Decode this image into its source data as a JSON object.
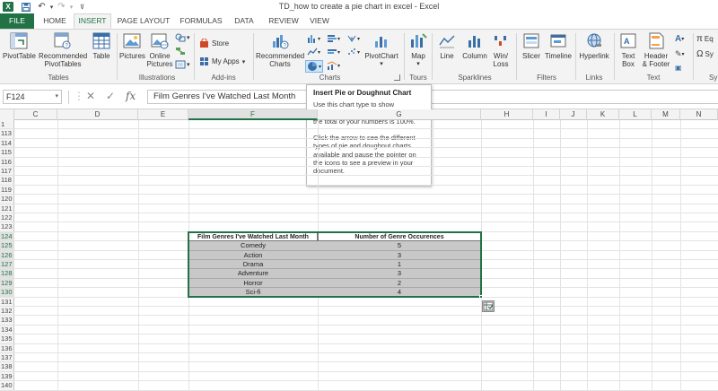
{
  "window": {
    "title": "TD_how to create a pie chart in excel - Excel",
    "logo_letter": "X"
  },
  "quick_access": {
    "save_icon": "save-icon",
    "undo_icon": "undo-icon",
    "redo_icon": "redo-icon",
    "customize_icon": "customize-icon"
  },
  "tabs": [
    {
      "label": "FILE"
    },
    {
      "label": "HOME"
    },
    {
      "label": "INSERT"
    },
    {
      "label": "PAGE LAYOUT"
    },
    {
      "label": "FORMULAS"
    },
    {
      "label": "DATA"
    },
    {
      "label": "REVIEW"
    },
    {
      "label": "VIEW"
    }
  ],
  "ribbon": {
    "tables": {
      "label": "Tables",
      "pivottable": "PivotTable",
      "recommended_pivottables": [
        "Recommended",
        "PivotTables"
      ],
      "table": "Table"
    },
    "illustrations": {
      "label": "Illustrations",
      "pictures": "Pictures",
      "online_pictures": [
        "Online",
        "Pictures"
      ]
    },
    "addins": {
      "label": "Add-ins",
      "store": "Store",
      "my_apps": "My Apps"
    },
    "charts": {
      "label": "Charts",
      "recommended_charts": [
        "Recommended",
        "Charts"
      ],
      "pivotchart": "PivotChart"
    },
    "tours": {
      "label": "Tours",
      "map": "Map"
    },
    "sparklines": {
      "label": "Sparklines",
      "line": "Line",
      "column": "Column",
      "winloss": [
        "Win/",
        "Loss"
      ]
    },
    "filters": {
      "label": "Filters",
      "slicer": "Slicer",
      "timeline": "Timeline"
    },
    "links": {
      "label": "Links",
      "hyperlink": "Hyperlink"
    },
    "text": {
      "label": "Text",
      "text_box": [
        "Text",
        "Box"
      ],
      "header_footer": [
        "Header",
        "& Footer"
      ]
    },
    "symbols": {
      "label": "Sy",
      "equation": "Eq",
      "symbol": "Sy"
    }
  },
  "formula_bar": {
    "name_box": "F124",
    "content": "Film Genres I've Watched Last Month"
  },
  "columns": [
    "C",
    "D",
    "E",
    "F",
    "G",
    "H",
    "I",
    "J",
    "K",
    "L",
    "M",
    "N"
  ],
  "rows": [
    "1",
    "113",
    "114",
    "115",
    "116",
    "117",
    "118",
    "119",
    "120",
    "121",
    "122",
    "123",
    "124",
    "125",
    "126",
    "127",
    "128",
    "129",
    "130",
    "131",
    "132",
    "133",
    "134",
    "135",
    "136",
    "137",
    "138",
    "139",
    "140"
  ],
  "table": {
    "header": [
      "Film Genres I've Watched Last Month",
      "Number of Genre Occurences"
    ],
    "rows": [
      {
        "genre": "Comedy",
        "count": "5"
      },
      {
        "genre": "Action",
        "count": "3"
      },
      {
        "genre": "Drama",
        "count": "1"
      },
      {
        "genre": "Adventure",
        "count": "3"
      },
      {
        "genre": "Horror",
        "count": "2"
      },
      {
        "genre": "Sci-fi",
        "count": "4"
      }
    ]
  },
  "tooltip": {
    "title": "Insert Pie or Doughnut Chart",
    "p1": "Use this chart type to show proportions of a whole. Use it when the total of your numbers is 100%.",
    "p2": "Click the arrow to see the different types of pie and doughnut charts available and pause the pointer on the icons to see a preview in your document."
  },
  "colors": {
    "excel_green": "#217346",
    "ribbon_bg": "#f3f3f3",
    "selected_cells": "#c8c8c8"
  }
}
